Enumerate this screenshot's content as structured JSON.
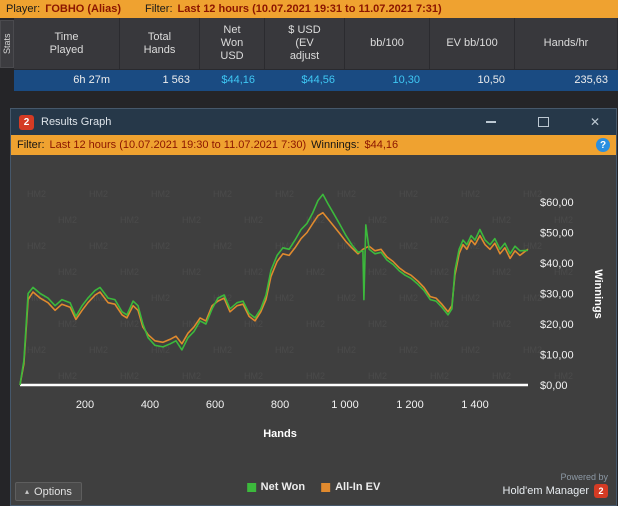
{
  "app": {
    "player_bar": {
      "player_label": "Player:",
      "player_name": "ГОВНО (Alias)",
      "filter_label": "Filter:",
      "filter_value": "Last 12 hours (10.07.2021 19:31 to 11.07.2021 7:31)"
    },
    "stats_tab": "Stats",
    "stats_table": {
      "columns": [
        "Time\nPlayed",
        "Total\nHands",
        "Net\nWon\nUSD",
        "$ USD\n(EV\nadjust",
        "bb/100",
        "EV bb/100",
        "Hands/hr"
      ],
      "row": [
        {
          "value": "6h 27m",
          "color": "#EDEDED"
        },
        {
          "value": "1 563",
          "color": "#EDEDED"
        },
        {
          "value": "$44,16",
          "color": "#3FC8F4"
        },
        {
          "value": "$44,56",
          "color": "#3FC8F4"
        },
        {
          "value": "10,30",
          "color": "#3FC8F4"
        },
        {
          "value": "10,50",
          "color": "#EDEDED"
        },
        {
          "value": "235,63",
          "color": "#EDEDED"
        }
      ]
    }
  },
  "window": {
    "title": "Results Graph",
    "logo": "2",
    "controls": {
      "close": "✕"
    },
    "filter_bar": {
      "filter_label": "Filter:",
      "filter_value": "Last 12 hours (10.07.2021 19:30 to 11.07.2021 7:30)",
      "winnings_label": "Winnings:",
      "winnings_value": "$44,16",
      "info": "?"
    },
    "footer": {
      "legend": [
        {
          "label": "Net Won",
          "color": "#3CB93C"
        },
        {
          "label": "All-In EV",
          "color": "#E08A2E"
        }
      ],
      "options_label": "Options",
      "options_icon": "▴",
      "powered_by": "Powered by",
      "brand": "Hold'em Manager",
      "brand_logo": "2"
    }
  },
  "colors": {
    "accent_orange": "#EFA230",
    "net_won_green": "#3CB93C",
    "all_in_ev_orange": "#E08A2E",
    "winnings_cyan": "#3FC8F4",
    "selected_row_blue": "#1A4B82",
    "brand_red": "#D43B24",
    "plot_background": "#3F3F3F",
    "zero_line": "#FFFFFF"
  },
  "chart_data": {
    "type": "line",
    "title": "",
    "xlabel": "Hands",
    "ylabel": "Winnings",
    "xlim": [
      0,
      1563
    ],
    "ylim": [
      -5,
      67
    ],
    "grid": false,
    "legend_position": "bottom",
    "watermark": "HM2",
    "x_ticks": {
      "values": [
        200,
        400,
        600,
        800,
        1000,
        1200,
        1400
      ],
      "labels": [
        "200",
        "400",
        "600",
        "800",
        "1 000",
        "1 200",
        "1 400"
      ]
    },
    "y_ticks": {
      "values": [
        0,
        10,
        20,
        30,
        40,
        50,
        60
      ],
      "labels": [
        "$0,00",
        "$10,00",
        "$20,00",
        "$30,00",
        "$40,00",
        "$50,00",
        "$60,00"
      ]
    },
    "zero_line": 0,
    "series": [
      {
        "name": "Net Won",
        "color": "#3CB93C",
        "final_value": 44.16,
        "points": [
          [
            0,
            0
          ],
          [
            12,
            8
          ],
          [
            25,
            30
          ],
          [
            40,
            32
          ],
          [
            62,
            30
          ],
          [
            86,
            28.5
          ],
          [
            108,
            26
          ],
          [
            129,
            28
          ],
          [
            154,
            27
          ],
          [
            172,
            22.5
          ],
          [
            191,
            26
          ],
          [
            209,
            28.5
          ],
          [
            231,
            31
          ],
          [
            246,
            32
          ],
          [
            271,
            28.5
          ],
          [
            292,
            28
          ],
          [
            314,
            24
          ],
          [
            329,
            23
          ],
          [
            348,
            27.5
          ],
          [
            363,
            26
          ],
          [
            378,
            20
          ],
          [
            394,
            15.5
          ],
          [
            415,
            13
          ],
          [
            440,
            12.5
          ],
          [
            462,
            13.5
          ],
          [
            480,
            14.5
          ],
          [
            498,
            11.5
          ],
          [
            517,
            15.5
          ],
          [
            535,
            17.5
          ],
          [
            554,
            21
          ],
          [
            572,
            20
          ],
          [
            591,
            25
          ],
          [
            609,
            28.5
          ],
          [
            628,
            29.5
          ],
          [
            646,
            25
          ],
          [
            668,
            27
          ],
          [
            686,
            27.5
          ],
          [
            705,
            23.5
          ],
          [
            723,
            22
          ],
          [
            741,
            25
          ],
          [
            757,
            29.5
          ],
          [
            772,
            37.5
          ],
          [
            791,
            42.5
          ],
          [
            809,
            45
          ],
          [
            828,
            44.5
          ],
          [
            846,
            47.5
          ],
          [
            865,
            51
          ],
          [
            883,
            53
          ],
          [
            901,
            56.5
          ],
          [
            917,
            60.5
          ],
          [
            932,
            62.5
          ],
          [
            947,
            59.5
          ],
          [
            966,
            56
          ],
          [
            985,
            52.5
          ],
          [
            1003,
            49
          ],
          [
            1021,
            46
          ],
          [
            1040,
            43.5
          ],
          [
            1055,
            44
          ],
          [
            1058,
            28
          ],
          [
            1064,
            52.5
          ],
          [
            1074,
            44.5
          ],
          [
            1092,
            43
          ],
          [
            1111,
            43.5
          ],
          [
            1129,
            41
          ],
          [
            1148,
            39.5
          ],
          [
            1166,
            37.5
          ],
          [
            1185,
            36
          ],
          [
            1203,
            35
          ],
          [
            1225,
            33
          ],
          [
            1243,
            31
          ],
          [
            1262,
            28
          ],
          [
            1280,
            27.5
          ],
          [
            1298,
            25.5
          ],
          [
            1317,
            23
          ],
          [
            1329,
            25
          ],
          [
            1338,
            37.5
          ],
          [
            1351,
            44.5
          ],
          [
            1363,
            47.5
          ],
          [
            1375,
            46
          ],
          [
            1388,
            49
          ],
          [
            1400,
            47.5
          ],
          [
            1415,
            51
          ],
          [
            1431,
            47.5
          ],
          [
            1446,
            46
          ],
          [
            1461,
            48
          ],
          [
            1477,
            44.5
          ],
          [
            1492,
            46.5
          ],
          [
            1508,
            43
          ],
          [
            1523,
            45.5
          ],
          [
            1538,
            44
          ],
          [
            1563,
            44.16
          ]
        ]
      },
      {
        "name": "All-In EV",
        "color": "#E08A2E",
        "final_value": 44.56,
        "points": [
          [
            0,
            0
          ],
          [
            12,
            7
          ],
          [
            25,
            28
          ],
          [
            40,
            30.5
          ],
          [
            62,
            28.5
          ],
          [
            86,
            27
          ],
          [
            108,
            24.5
          ],
          [
            129,
            26.5
          ],
          [
            154,
            25.5
          ],
          [
            172,
            21.5
          ],
          [
            191,
            24.5
          ],
          [
            209,
            27
          ],
          [
            231,
            29.5
          ],
          [
            246,
            30.5
          ],
          [
            271,
            27
          ],
          [
            292,
            26.5
          ],
          [
            314,
            23
          ],
          [
            329,
            22
          ],
          [
            348,
            26
          ],
          [
            363,
            24.5
          ],
          [
            378,
            19
          ],
          [
            394,
            16.5
          ],
          [
            415,
            14.5
          ],
          [
            440,
            14
          ],
          [
            462,
            15
          ],
          [
            480,
            16
          ],
          [
            498,
            13.5
          ],
          [
            517,
            17
          ],
          [
            535,
            19
          ],
          [
            554,
            22
          ],
          [
            572,
            21
          ],
          [
            591,
            26
          ],
          [
            609,
            27.5
          ],
          [
            628,
            28.5
          ],
          [
            646,
            24
          ],
          [
            668,
            26
          ],
          [
            686,
            26.5
          ],
          [
            705,
            22.5
          ],
          [
            723,
            21
          ],
          [
            741,
            24
          ],
          [
            757,
            28
          ],
          [
            772,
            35.5
          ],
          [
            791,
            40.5
          ],
          [
            809,
            43
          ],
          [
            828,
            42.5
          ],
          [
            846,
            45
          ],
          [
            865,
            48
          ],
          [
            883,
            50
          ],
          [
            901,
            53
          ],
          [
            917,
            55.5
          ],
          [
            932,
            56.5
          ],
          [
            947,
            54.5
          ],
          [
            966,
            52
          ],
          [
            985,
            49.5
          ],
          [
            1003,
            47
          ],
          [
            1021,
            45
          ],
          [
            1040,
            43
          ],
          [
            1055,
            44.5
          ],
          [
            1064,
            45
          ],
          [
            1074,
            45.5
          ],
          [
            1092,
            44
          ],
          [
            1111,
            44.5
          ],
          [
            1129,
            42
          ],
          [
            1148,
            40.5
          ],
          [
            1166,
            38.5
          ],
          [
            1185,
            37
          ],
          [
            1203,
            36
          ],
          [
            1225,
            34
          ],
          [
            1243,
            32
          ],
          [
            1262,
            29
          ],
          [
            1280,
            28.5
          ],
          [
            1298,
            26.5
          ],
          [
            1317,
            24
          ],
          [
            1329,
            26
          ],
          [
            1338,
            36
          ],
          [
            1351,
            43
          ],
          [
            1363,
            46
          ],
          [
            1375,
            44.5
          ],
          [
            1388,
            47.5
          ],
          [
            1400,
            46
          ],
          [
            1415,
            49
          ],
          [
            1431,
            46
          ],
          [
            1446,
            44.5
          ],
          [
            1461,
            46.5
          ],
          [
            1477,
            43
          ],
          [
            1492,
            45
          ],
          [
            1508,
            41.5
          ],
          [
            1523,
            44
          ],
          [
            1538,
            42.5
          ],
          [
            1563,
            44.56
          ]
        ]
      }
    ]
  }
}
